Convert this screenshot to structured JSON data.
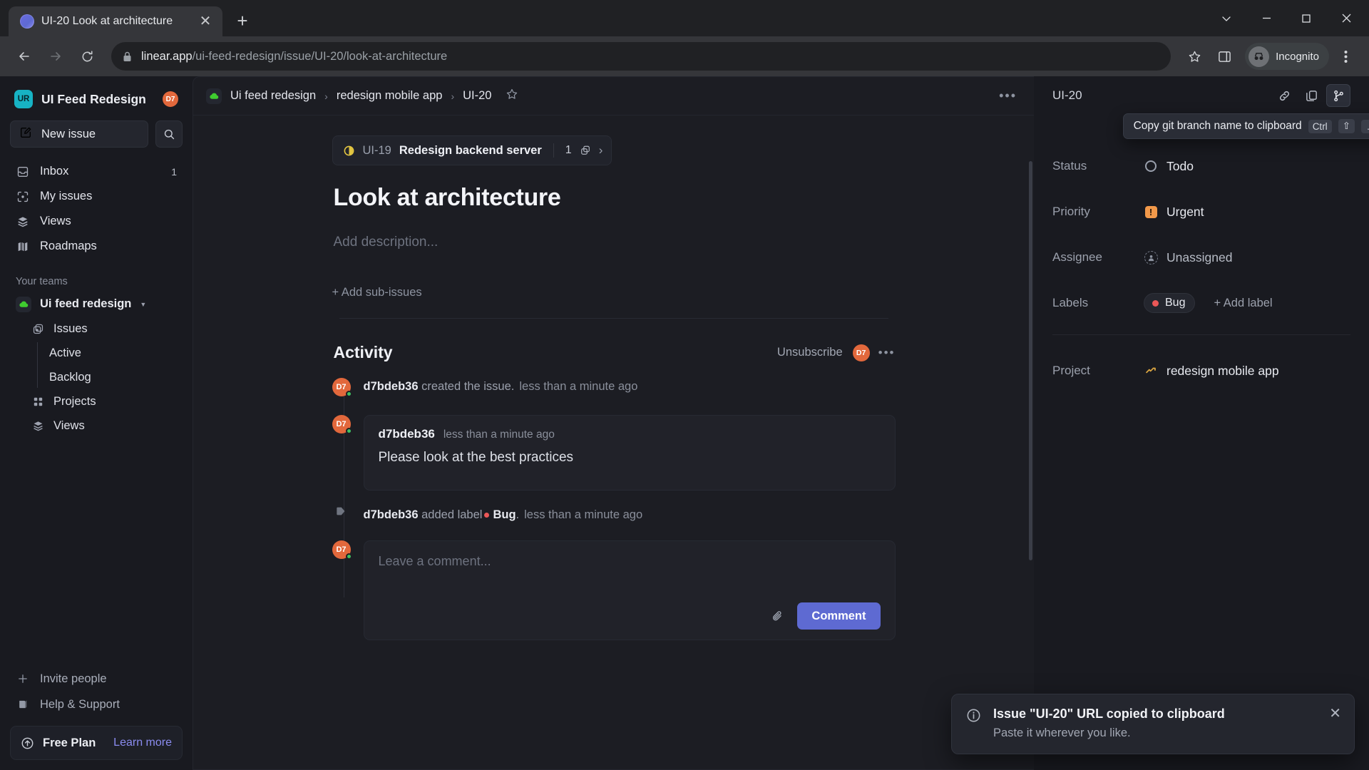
{
  "browser": {
    "tab": {
      "title": "UI-20 Look at architecture",
      "favicon": "linear-logo-icon",
      "close": "✕"
    },
    "new_tab": "+",
    "window_controls": {
      "minimize_group": "chevron-down-icon",
      "minimize": "minimize-icon",
      "maximize": "maximize-icon",
      "close": "close-icon"
    },
    "address": {
      "host": "linear.app",
      "path": "/ui-feed-redesign/issue/UI-20/look-at-architecture",
      "lock": "lock-icon",
      "bookmark": "star-icon"
    },
    "profile": {
      "label": "Incognito"
    }
  },
  "sidebar": {
    "workspace": {
      "initials": "UR",
      "name": "UI Feed Redesign",
      "avatar_initials": "D7"
    },
    "new_issue": "New issue",
    "search_placeholder": "Search",
    "nav": [
      {
        "label": "Inbox",
        "icon": "inbox-icon",
        "badge": "1"
      },
      {
        "label": "My issues",
        "icon": "my-issues-icon",
        "badge": ""
      },
      {
        "label": "Views",
        "icon": "layers-icon",
        "badge": ""
      },
      {
        "label": "Roadmaps",
        "icon": "roadmap-icon",
        "badge": ""
      }
    ],
    "teams_label": "Your teams",
    "team": {
      "name": "Ui feed redesign",
      "icon": "green-cloud-icon"
    },
    "team_nav": [
      {
        "label": "Issues",
        "icon": "issues-icon"
      },
      {
        "label": "Projects",
        "icon": "grid-icon"
      },
      {
        "label": "Views",
        "icon": "layers-icon"
      }
    ],
    "issue_children": [
      {
        "label": "Active"
      },
      {
        "label": "Backlog"
      }
    ],
    "bottom": [
      {
        "label": "Invite people",
        "icon": "plus-icon"
      },
      {
        "label": "Help & Support",
        "icon": "book-icon"
      }
    ],
    "plan": {
      "name": "Free Plan",
      "link": "Learn more",
      "icon": "upgrade-icon"
    }
  },
  "content": {
    "breadcrumb": {
      "team": "Ui feed redesign",
      "project": "redesign mobile app",
      "issue": "UI-20",
      "separator": "›",
      "favorite_icon": "star-icon"
    },
    "more_icon": "more-horizontal-icon",
    "parent_issue": {
      "id": "UI-19",
      "title": "Redesign backend server",
      "sub_count": "1",
      "status_icon": "in-progress-icon",
      "link_icon": "sub-issues-icon",
      "chevron": "›"
    },
    "title": "Look at architecture",
    "description_placeholder": "Add description...",
    "add_sub_issues": "+ Add sub-issues",
    "activity": {
      "heading": "Activity",
      "unsubscribe": "Unsubscribe",
      "avatar_initials": "D7",
      "more_icon": "more-horizontal-icon",
      "events": [
        {
          "type": "event",
          "user": "d7bdeb36",
          "text": "created the issue.",
          "time": "less than a minute ago",
          "avatar_initials": "D7"
        },
        {
          "type": "comment",
          "user": "d7bdeb36",
          "time": "less than a minute ago",
          "body": "Please look at the best practices",
          "avatar_initials": "D7"
        },
        {
          "type": "label-event",
          "user": "d7bdeb36",
          "text": "added label",
          "label": "Bug",
          "text_after": ".",
          "time": "less than a minute ago",
          "icon": "tag-icon"
        }
      ]
    },
    "composer": {
      "placeholder": "Leave a comment...",
      "attach_icon": "paperclip-icon",
      "submit": "Comment",
      "avatar_initials": "D7"
    }
  },
  "right_panel": {
    "issue_id": "UI-20",
    "actions": [
      {
        "name": "copy-link-icon",
        "active": false
      },
      {
        "name": "copy-issue-icon",
        "active": false
      },
      {
        "name": "copy-git-branch-icon",
        "active": true
      }
    ],
    "tooltip": {
      "text": "Copy git branch name to clipboard",
      "keys": [
        "Ctrl",
        "⇧",
        "."
      ]
    },
    "properties": [
      {
        "label": "Status",
        "value": "Todo",
        "icon": "status-todo-icon"
      },
      {
        "label": "Priority",
        "value": "Urgent",
        "icon": "priority-urgent-icon"
      },
      {
        "label": "Assignee",
        "value": "Unassigned",
        "icon": "user-circle-icon"
      }
    ],
    "labels": {
      "label": "Labels",
      "chips": [
        {
          "text": "Bug",
          "color": "#eb5757"
        }
      ],
      "add": "+ Add label"
    },
    "project": {
      "label": "Project",
      "value": "redesign mobile app",
      "icon": "project-icon"
    }
  },
  "toast": {
    "title": "Issue \"UI-20\" URL copied to clipboard",
    "subtitle": "Paste it wherever you like.",
    "info_icon": "info-icon",
    "close": "✕"
  }
}
